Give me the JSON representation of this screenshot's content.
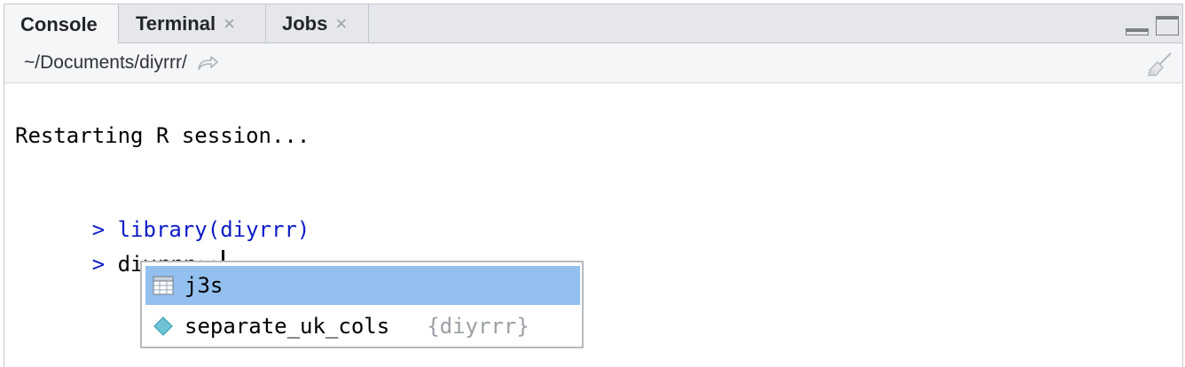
{
  "tabs": [
    {
      "label": "Console",
      "active": true
    },
    {
      "label": "Terminal",
      "close": "×"
    },
    {
      "label": "Jobs",
      "close": "×"
    }
  ],
  "path_bar": {
    "path": "~/Documents/diyrrr/"
  },
  "console": {
    "output_line": "Restarting R session...",
    "prompt_symbol": ">",
    "history_command": "library(diyrrr)",
    "current_input_pkg": "diyrrr",
    "current_input_sep": "::"
  },
  "completion": {
    "items": [
      {
        "label": "j3s",
        "icon": "table-icon",
        "package": "",
        "selected": true
      },
      {
        "label": "separate_uk_cols",
        "icon": "function-icon",
        "package": "{diyrrr}",
        "selected": false
      }
    ]
  },
  "colors": {
    "tab_strip": "#e5e7ea",
    "prompt_blue": "#0e1bc4",
    "selection": "#93c0ee"
  }
}
